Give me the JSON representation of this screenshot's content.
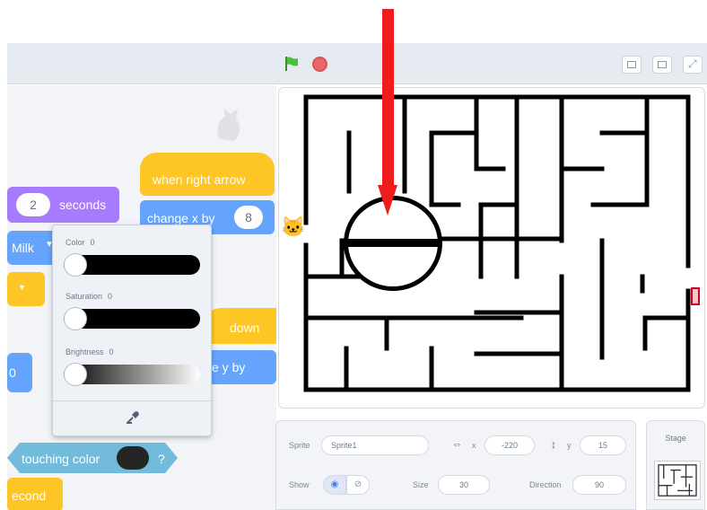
{
  "toolbar": {
    "green_flag_icon": "green-flag-icon",
    "stop_icon": "stop-icon",
    "stage_modes": [
      "small-stage-icon",
      "normal-stage-icon",
      "fullscreen-icon"
    ]
  },
  "code_blocks": {
    "wait_value": "2",
    "wait_unit": "seconds",
    "when_key_pressed": "when right arrow",
    "change_x_by": "change x by",
    "change_x_value": "8",
    "milk_dropdown": "Milk",
    "key_down": "down",
    "change_y_by": "e y by",
    "touching_color": "touching color",
    "touching_question": "?",
    "left_partial_value": "0",
    "bottom_block": "econd"
  },
  "color_popover": {
    "color_label": "Color",
    "color_value": "0",
    "saturation_label": "Saturation",
    "saturation_value": "0",
    "brightness_label": "Brightness",
    "brightness_value": "0",
    "eyedropper_icon": "eyedropper-icon"
  },
  "sprite_info": {
    "sprite_label": "Sprite",
    "sprite_name": "Sprite1",
    "x_label": "x",
    "x_value": "-220",
    "y_label": "y",
    "y_value": "15",
    "show_label": "Show",
    "size_label": "Size",
    "size_value": "30",
    "direction_label": "Direction",
    "direction_value": "90"
  },
  "stage_panel": {
    "label": "Stage"
  },
  "colors": {
    "accent_red": "#ee1c1c",
    "motion_blue": "#4c97ff",
    "looks_purple": "#9966ff",
    "events_yellow": "#ffbf00",
    "sensing_cyan": "#5cb1d6"
  }
}
